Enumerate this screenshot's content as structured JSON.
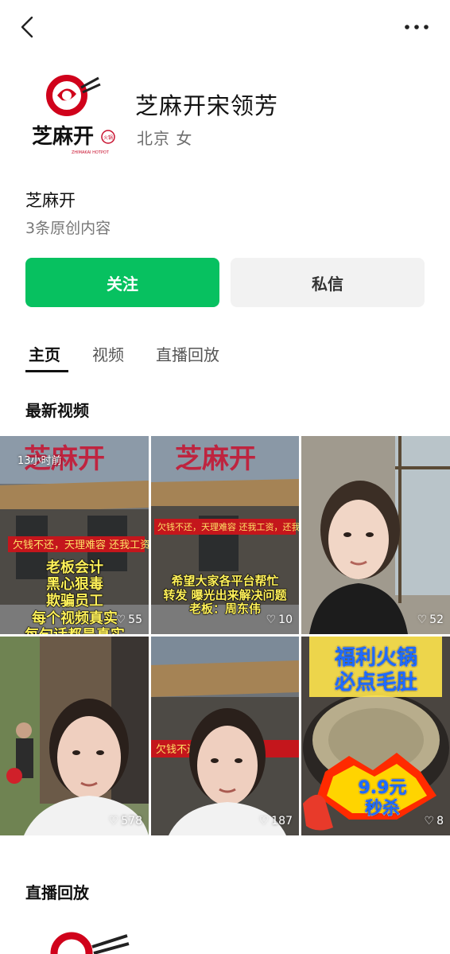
{
  "header": {
    "back_icon": "chevron-left-icon",
    "more_icon": "more-dots-icon"
  },
  "profile": {
    "avatar_logo_text": "芝麻开",
    "avatar_logo_subtext": "ZHIMAKAI HOTPOT",
    "avatar_logo_badge": "火锅",
    "name": "芝麻开宋领芳",
    "meta": "北京 女"
  },
  "bio": {
    "title": "芝麻开",
    "subtitle": "3条原创内容"
  },
  "actions": {
    "follow_label": "关注",
    "message_label": "私信"
  },
  "tabs": [
    {
      "label": "主页",
      "active": true
    },
    {
      "label": "视频",
      "active": false
    },
    {
      "label": "直播回放",
      "active": false
    }
  ],
  "sections": {
    "latest_videos": "最新视频",
    "live_replay": "直播回放"
  },
  "videos": [
    {
      "likes": "55",
      "timestamp": "13小时前",
      "banner": "欠钱不还，天理难容  还我工资",
      "caption_lines": [
        "老板会计",
        "黑心狠毒",
        "欺骗员工",
        "每个视频真实",
        "每句话都是真实"
      ]
    },
    {
      "likes": "10",
      "banner": "欠钱不还，天理难容 还我工资，还我血汗钱",
      "caption_lines": [
        "希望大家各平台帮忙",
        "转发 曝光出来解决问题",
        "老板：周东伟"
      ]
    },
    {
      "likes": "52"
    },
    {
      "likes": "578"
    },
    {
      "likes": "187",
      "banner": "欠钱不还"
    },
    {
      "likes": "8",
      "promo_lines": [
        "福利火锅",
        "必点毛肚"
      ],
      "price_lines": [
        "9.9元",
        "秒杀"
      ]
    }
  ],
  "colors": {
    "accent_green": "#07c160",
    "brand_red": "#c8102e"
  }
}
